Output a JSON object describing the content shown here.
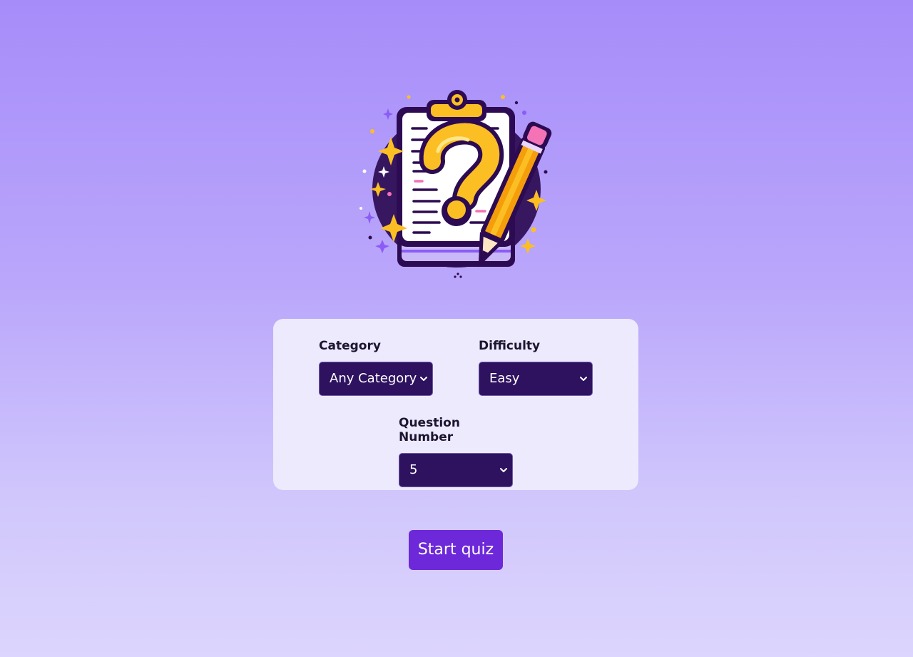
{
  "logo": {
    "icon": "quiz-clipboard-question-pencil-icon",
    "colors": {
      "outline": "#2d0b52",
      "gold": "#fbbf24",
      "orange": "#f59e0b",
      "paper": "#ffffff",
      "pink": "#f472b6",
      "purple": "#8b5cf6"
    }
  },
  "settings": {
    "category": {
      "label": "Category",
      "selected": "Any Category"
    },
    "difficulty": {
      "label": "Difficulty",
      "selected": "Easy"
    },
    "question_number": {
      "label": "Question Number",
      "selected": "5"
    }
  },
  "actions": {
    "start_label": "Start quiz"
  },
  "colors": {
    "background_top": "#a68cf9",
    "background_bottom": "#dcd5fd",
    "panel": "#edeafd",
    "select_bg": "#2e1260",
    "button": "#6d28d9"
  }
}
